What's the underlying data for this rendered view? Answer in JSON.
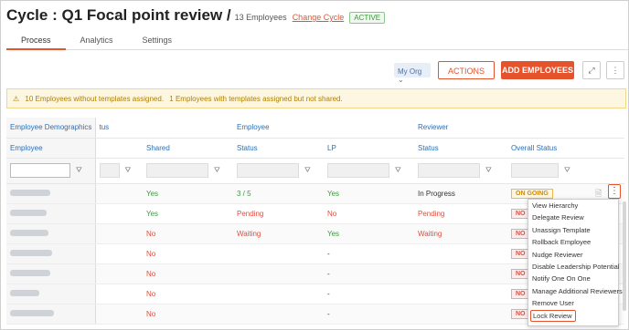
{
  "header": {
    "title": "Cycle : Q1 Focal point review /",
    "employees": "13 Employees",
    "change": "Change Cycle",
    "status": "ACTIVE"
  },
  "tabs": [
    "Process",
    "Analytics",
    "Settings"
  ],
  "toolbar": {
    "myorg": "My Org",
    "actions": "ACTIONS",
    "add": "ADD EMPLOYEES",
    "expand_icon": "expand-icon",
    "more_icon": "more-vertical-icon"
  },
  "alert": {
    "icon": "warning-icon",
    "text1": "10 Employees without templates assigned.",
    "text2": "1 Employees with templates assigned but not shared."
  },
  "table": {
    "groups": [
      "Employee Demographics",
      "tus",
      "",
      "Employee",
      "",
      "Reviewer",
      ""
    ],
    "columns": [
      "Employee",
      "",
      "Shared",
      "Status",
      "LP",
      "Status",
      "Overall Status"
    ],
    "rows": [
      {
        "shared": "Yes",
        "status": "3 / 5",
        "lp": "Yes",
        "rstatus": "In Progress",
        "overall": "ON GOING"
      },
      {
        "shared": "Yes",
        "status": "Pending",
        "lp": "No",
        "rstatus": "Pending",
        "overall": "NO"
      },
      {
        "shared": "No",
        "status": "Waiting",
        "lp": "Yes",
        "rstatus": "Waiting",
        "overall": "NO"
      },
      {
        "shared": "No",
        "status": "",
        "lp": "-",
        "rstatus": "",
        "overall": "NO"
      },
      {
        "shared": "No",
        "status": "",
        "lp": "-",
        "rstatus": "",
        "overall": "NO"
      },
      {
        "shared": "No",
        "status": "",
        "lp": "-",
        "rstatus": "",
        "overall": "NO"
      },
      {
        "shared": "No",
        "status": "",
        "lp": "-",
        "rstatus": "",
        "overall": "NO"
      }
    ]
  },
  "menu": [
    "View Hierarchy",
    "Delegate Review",
    "Unassign Template",
    "Rollback Employee",
    "Nudge Reviewer",
    "Disable Leadership Potential",
    "Notify One On One",
    "Manage Additional Reviewers",
    "Remove User",
    "Lock Review"
  ]
}
